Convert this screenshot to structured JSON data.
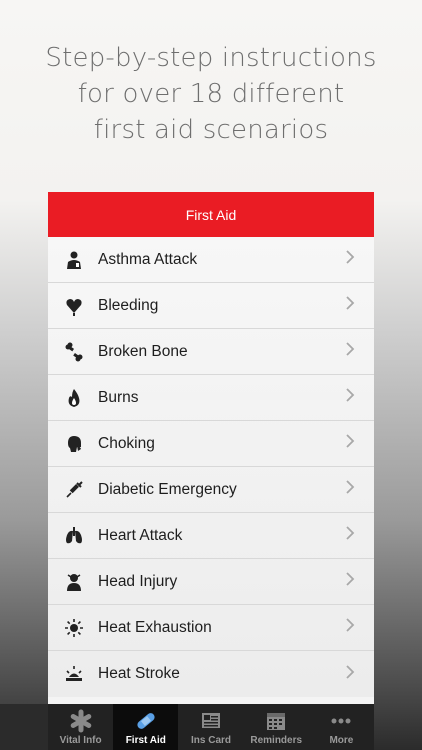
{
  "headline": {
    "line1": "Step-by-step instructions",
    "line2": "for over 18 different",
    "line3": "first aid scenarios"
  },
  "navbar": {
    "title": "First Aid"
  },
  "list": [
    {
      "label": "Asthma Attack",
      "icon": "asthma-icon"
    },
    {
      "label": "Bleeding",
      "icon": "bleeding-icon"
    },
    {
      "label": "Broken Bone",
      "icon": "bone-icon"
    },
    {
      "label": "Burns",
      "icon": "fire-icon"
    },
    {
      "label": "Choking",
      "icon": "choking-icon"
    },
    {
      "label": "Diabetic Emergency",
      "icon": "syringe-icon"
    },
    {
      "label": "Heart Attack",
      "icon": "lungs-icon"
    },
    {
      "label": "Head Injury",
      "icon": "head-injury-icon"
    },
    {
      "label": "Heat Exhaustion",
      "icon": "sun-icon"
    },
    {
      "label": "Heat Stroke",
      "icon": "heat-stroke-icon"
    }
  ],
  "tabbar": {
    "tabs": [
      {
        "label": "Vital Info",
        "icon": "asterisk-icon"
      },
      {
        "label": "First Aid",
        "icon": "bandage-icon",
        "active": true
      },
      {
        "label": "Ins Card",
        "icon": "card-icon"
      },
      {
        "label": "Reminders",
        "icon": "calendar-icon"
      },
      {
        "label": "More",
        "icon": "more-dots-icon"
      }
    ]
  },
  "colors": {
    "accent": "#ea1c24",
    "tabbar": "#222222"
  }
}
